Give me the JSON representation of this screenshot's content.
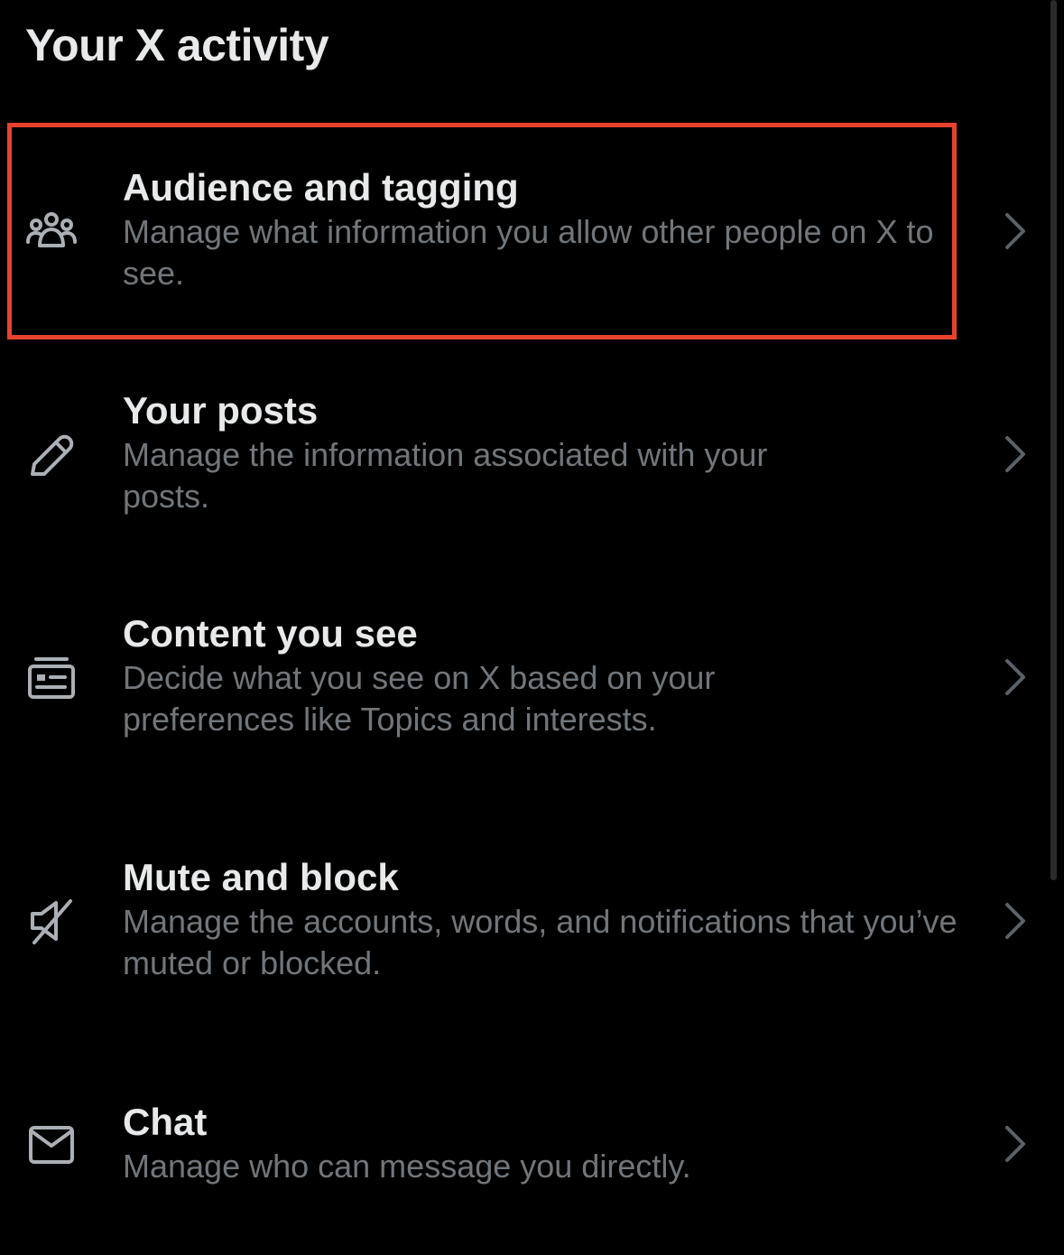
{
  "page": {
    "title": "Your X activity"
  },
  "colors": {
    "background": "#000000",
    "title_text": "#e7e9ea",
    "secondary_text": "#71767b",
    "icon": "#aab0b5",
    "highlight_border": "#e8422e"
  },
  "items": [
    {
      "title": "Audience and tagging",
      "description": "Manage what information you allow other people on X to see.",
      "icon": "people-group-icon",
      "highlighted": true
    },
    {
      "title": "Your posts",
      "description": "Manage the information associated with your posts.",
      "icon": "pencil-icon",
      "highlighted": false
    },
    {
      "title": "Content you see",
      "description": "Decide what you see on X based on your preferences like Topics and interests.",
      "icon": "content-card-icon",
      "highlighted": false
    },
    {
      "title": "Mute and block",
      "description": "Manage the accounts, words, and notifications that you’ve muted or blocked.",
      "icon": "speaker-muted-icon",
      "highlighted": false
    },
    {
      "title": "Chat",
      "description": "Manage who can message you directly.",
      "icon": "envelope-icon",
      "highlighted": false
    }
  ]
}
